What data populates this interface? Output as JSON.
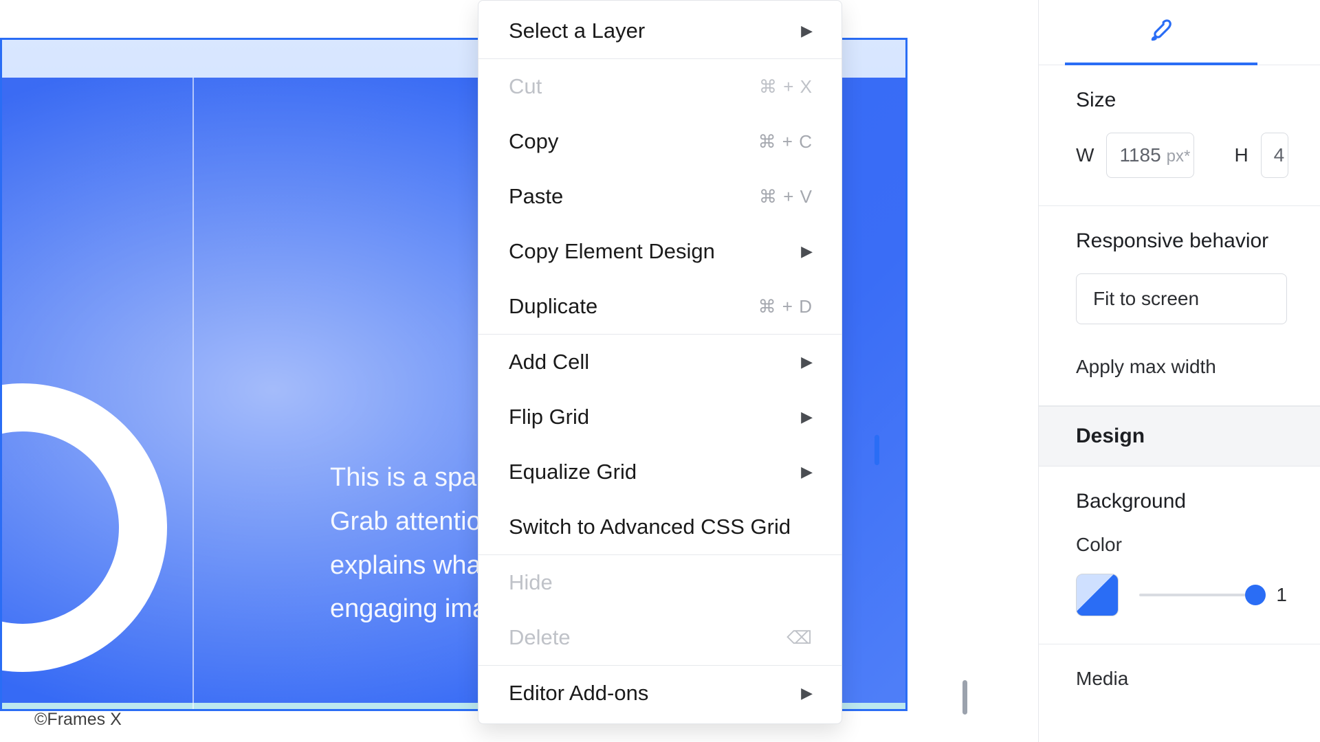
{
  "canvas": {
    "hero_text": "This is a space for introducing the site. Grab attention with copy that clearly explains what it is about, and add an engaging image or video.",
    "watermark": "©Frames X"
  },
  "context_menu": {
    "items": [
      {
        "label": "Select a Layer",
        "shortcut": "",
        "submenu": true,
        "disabled": false
      },
      {
        "sep": true
      },
      {
        "label": "Cut",
        "shortcut": "⌘ + X",
        "submenu": false,
        "disabled": true
      },
      {
        "label": "Copy",
        "shortcut": "⌘ + C",
        "submenu": false,
        "disabled": false
      },
      {
        "label": "Paste",
        "shortcut": "⌘ + V",
        "submenu": false,
        "disabled": false
      },
      {
        "label": "Copy Element Design",
        "shortcut": "",
        "submenu": true,
        "disabled": false
      },
      {
        "label": "Duplicate",
        "shortcut": "⌘ + D",
        "submenu": false,
        "disabled": false
      },
      {
        "sep": true
      },
      {
        "label": "Add Cell",
        "shortcut": "",
        "submenu": true,
        "disabled": false
      },
      {
        "label": "Flip Grid",
        "shortcut": "",
        "submenu": true,
        "disabled": false
      },
      {
        "label": "Equalize Grid",
        "shortcut": "",
        "submenu": true,
        "disabled": false
      },
      {
        "label": "Switch to Advanced CSS Grid",
        "shortcut": "",
        "submenu": false,
        "disabled": false
      },
      {
        "sep": true
      },
      {
        "label": "Hide",
        "shortcut": "",
        "submenu": false,
        "disabled": true
      },
      {
        "label": "Delete",
        "shortcut": "",
        "submenu": false,
        "disabled": true,
        "delete_icon": true
      },
      {
        "sep": true
      },
      {
        "label": "Editor Add-ons",
        "shortcut": "",
        "submenu": true,
        "disabled": false
      }
    ]
  },
  "inspector": {
    "size_title": "Size",
    "w_label": "W",
    "w_value": "1185",
    "w_unit": "px*",
    "h_label": "H",
    "h_value": "4",
    "responsive_title": "Responsive behavior",
    "responsive_value": "Fit to screen",
    "max_width_label": "Apply max width",
    "design_title": "Design",
    "background_label": "Background",
    "color_label": "Color",
    "opacity_value": "1",
    "media_label": "Media"
  }
}
